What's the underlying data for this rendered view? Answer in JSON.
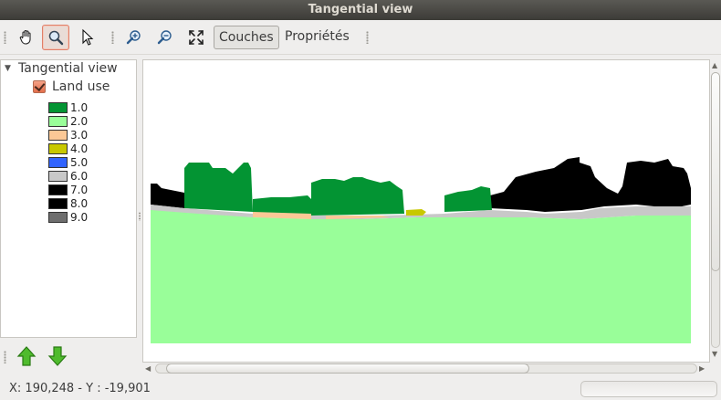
{
  "window": {
    "title": "Tangential view"
  },
  "toolbar": {
    "pan_tool": "hand-pan-icon",
    "zoom_tool": "magnifier-icon",
    "select_tool": "arrow-cursor-icon",
    "zoom_in": "zoom-in-icon",
    "zoom_out": "zoom-out-icon",
    "full_extent": "fit-extent-icon",
    "couches_label": "Couches",
    "proprietes_label": "Propriétés"
  },
  "layers_panel": {
    "root_label": "Tangential view",
    "layer_label": "Land use",
    "layer_checked": true,
    "legend": [
      {
        "label": "1.0",
        "color": "#039433"
      },
      {
        "label": "2.0",
        "color": "#99fe99"
      },
      {
        "label": "3.0",
        "color": "#fbc896"
      },
      {
        "label": "4.0",
        "color": "#c8c800"
      },
      {
        "label": "5.0",
        "color": "#3264fe"
      },
      {
        "label": "6.0",
        "color": "#c8c8c8"
      },
      {
        "label": "7.0",
        "color": "#000000"
      },
      {
        "label": "8.0",
        "color": "#000000"
      },
      {
        "label": "9.0",
        "color": "#6e6e6e"
      }
    ],
    "move_up_icon": "green-up-arrow-icon",
    "move_down_icon": "green-down-arrow-icon"
  },
  "statusbar": {
    "coordinates": "X: 190,248 - Y : -19,901",
    "progress": 0
  }
}
